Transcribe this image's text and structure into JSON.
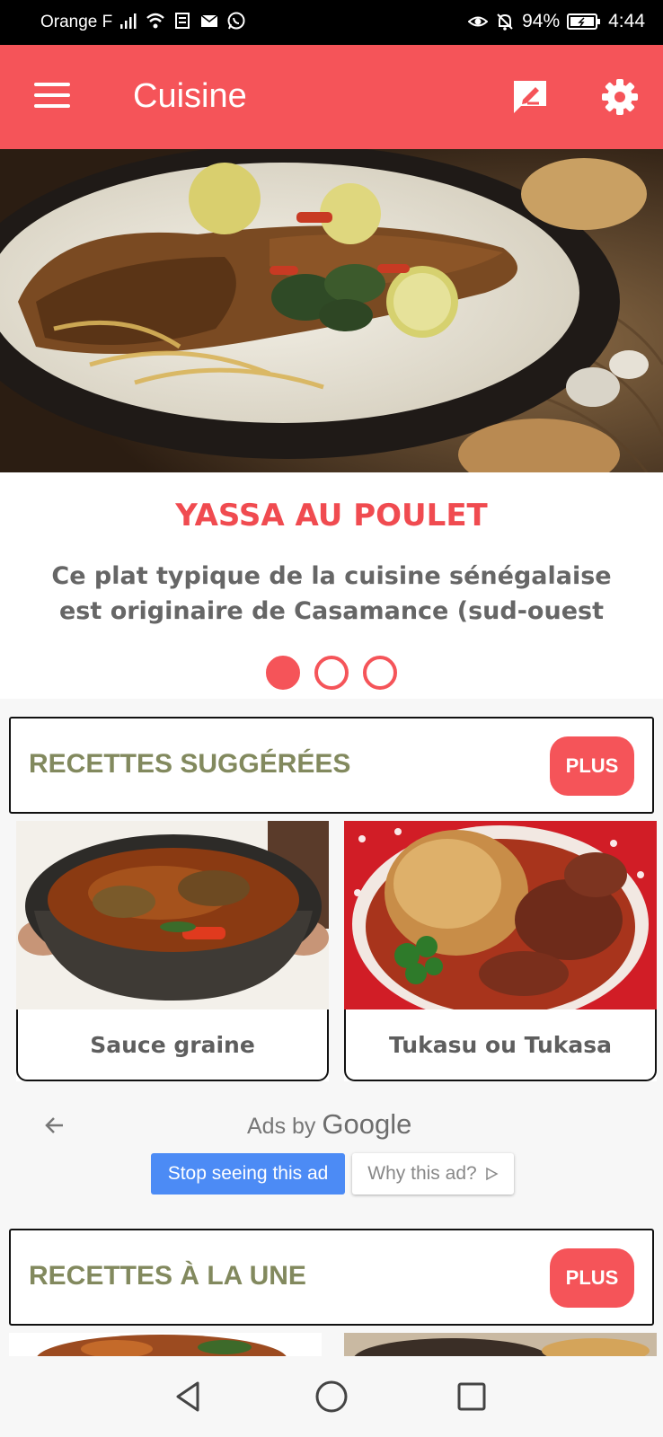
{
  "status_bar": {
    "carrier": "Orange F",
    "battery": "94%",
    "time": "4:44"
  },
  "app_bar": {
    "title": "Cuisine",
    "color": "#f55459"
  },
  "featured": {
    "title": "YASSA AU POULET",
    "description": "Ce plat typique de la cuisine sénégalaise est originaire de Casamance (sud-ouest",
    "pages": 3,
    "active_page": 1
  },
  "suggested": {
    "title": "RECETTES SUGGÉRÉES",
    "more_label": "PLUS",
    "items": [
      {
        "name": "Sauce graine"
      },
      {
        "name": "Tukasu ou Tukasa"
      }
    ]
  },
  "ad": {
    "ads_by": "Ads by",
    "google": "Google",
    "stop_label": "Stop seeing this ad",
    "why_label": "Why this ad?"
  },
  "featured_recipes": {
    "title": "RECETTES À LA UNE",
    "more_label": "PLUS"
  }
}
